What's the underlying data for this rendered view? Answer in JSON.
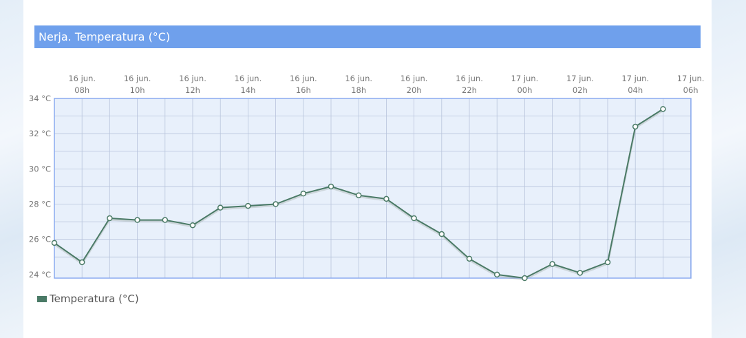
{
  "colors": {
    "title_bar": "#6fa0ec",
    "plot_background": "#e8f0fb",
    "plot_border": "#8aaaf0",
    "grid": "#b8c4dc",
    "series_line": "#4a7a66",
    "marker_fill": "#ffffff"
  },
  "chart_data": {
    "type": "line",
    "title": "Nerja. Temperatura (°C)",
    "xlabel": "",
    "ylabel": "",
    "x_ticks": [
      {
        "day": "16 jun.",
        "hour": "08h"
      },
      {
        "day": "16 jun.",
        "hour": "10h"
      },
      {
        "day": "16 jun.",
        "hour": "12h"
      },
      {
        "day": "16 jun.",
        "hour": "14h"
      },
      {
        "day": "16 jun.",
        "hour": "16h"
      },
      {
        "day": "16 jun.",
        "hour": "18h"
      },
      {
        "day": "16 jun.",
        "hour": "20h"
      },
      {
        "day": "16 jun.",
        "hour": "22h"
      },
      {
        "day": "17 jun.",
        "hour": "00h"
      },
      {
        "day": "17 jun.",
        "hour": "02h"
      },
      {
        "day": "17 jun.",
        "hour": "04h"
      },
      {
        "day": "17 jun.",
        "hour": "06h"
      }
    ],
    "y_ticks": [
      "24 °C",
      "26 °C",
      "28 °C",
      "30 °C",
      "32 °C",
      "34 °C"
    ],
    "ylim": [
      23.8,
      34
    ],
    "grid": true,
    "legend_position": "bottom-left",
    "x": [
      "16 jun. 07h",
      "16 jun. 08h",
      "16 jun. 09h",
      "16 jun. 10h",
      "16 jun. 11h",
      "16 jun. 12h",
      "16 jun. 13h",
      "16 jun. 14h",
      "16 jun. 15h",
      "16 jun. 16h",
      "16 jun. 17h",
      "16 jun. 18h",
      "16 jun. 19h",
      "16 jun. 20h",
      "16 jun. 21h",
      "16 jun. 22h",
      "16 jun. 23h",
      "17 jun. 00h",
      "17 jun. 01h",
      "17 jun. 02h",
      "17 jun. 03h",
      "17 jun. 04h",
      "17 jun. 05h"
    ],
    "series": [
      {
        "name": "Temperatura (°C)",
        "values": [
          25.8,
          24.7,
          27.2,
          27.1,
          27.1,
          26.8,
          27.8,
          27.9,
          28.0,
          28.6,
          29.0,
          28.5,
          28.3,
          27.2,
          26.3,
          24.9,
          24.0,
          23.8,
          24.6,
          24.1,
          24.7,
          32.4,
          33.4
        ]
      }
    ]
  }
}
